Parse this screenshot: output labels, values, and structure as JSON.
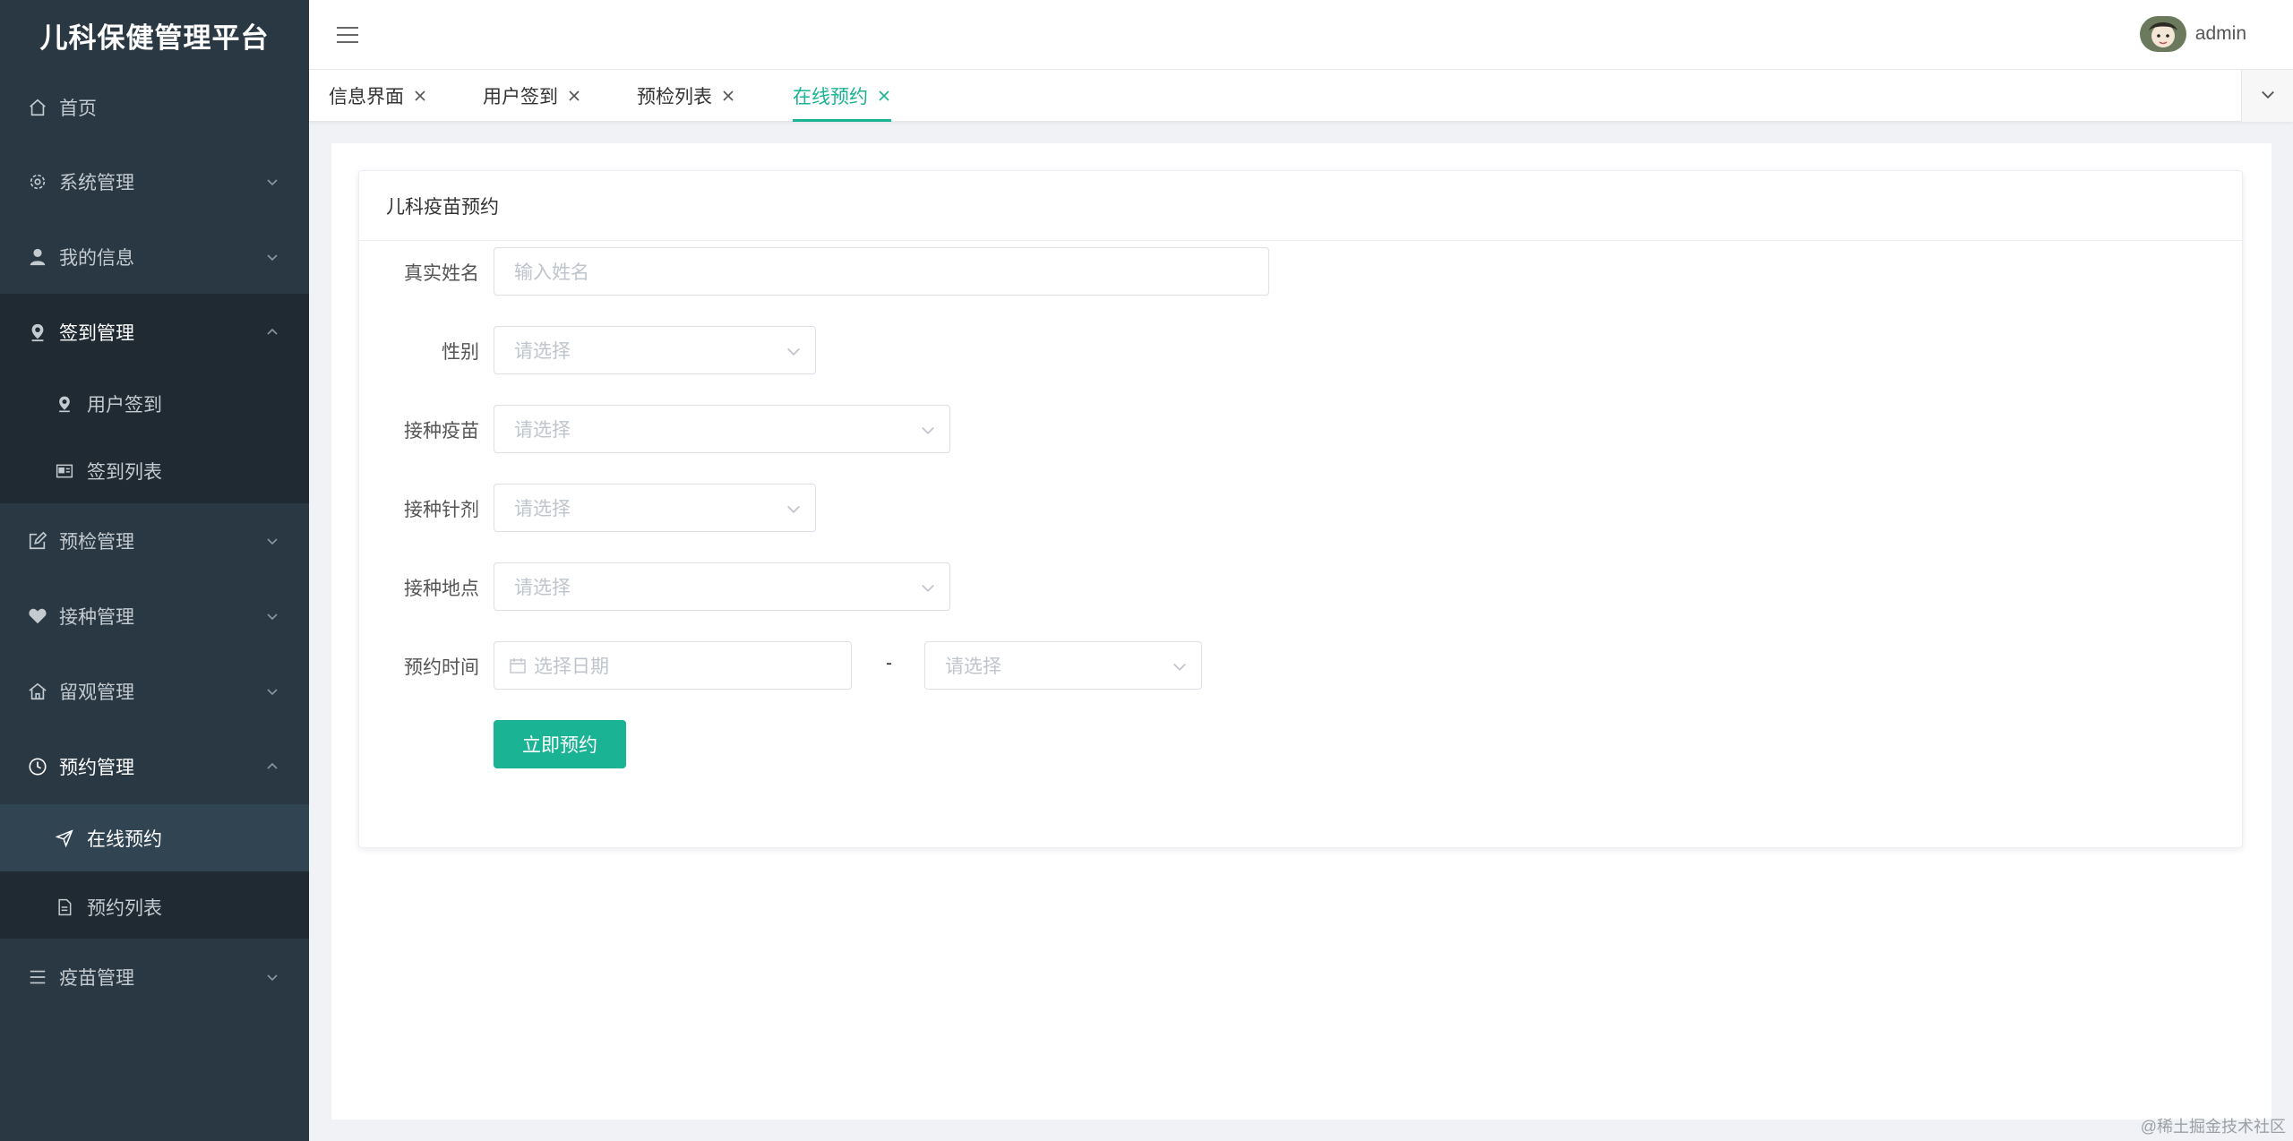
{
  "app": {
    "brand": "儿科保健管理平台"
  },
  "header": {
    "username": "admin"
  },
  "sidebar": {
    "items": [
      {
        "label": "首页",
        "icon": "home-icon"
      },
      {
        "label": "系统管理",
        "icon": "gear-icon"
      },
      {
        "label": "我的信息",
        "icon": "user-icon"
      },
      {
        "label": "签到管理",
        "icon": "location-pin-icon"
      },
      {
        "label": "用户签到",
        "icon": "location-pin-icon"
      },
      {
        "label": "签到列表",
        "icon": "id-card-icon"
      },
      {
        "label": "预检管理",
        "icon": "edit-icon"
      },
      {
        "label": "接种管理",
        "icon": "heart-icon"
      },
      {
        "label": "留观管理",
        "icon": "house-icon"
      },
      {
        "label": "预约管理",
        "icon": "clock-icon"
      },
      {
        "label": "在线预约",
        "icon": "send-icon"
      },
      {
        "label": "预约列表",
        "icon": "document-icon"
      },
      {
        "label": "疫苗管理",
        "icon": "list-icon"
      }
    ]
  },
  "tabs": [
    {
      "label": "信息界面"
    },
    {
      "label": "用户签到"
    },
    {
      "label": "预检列表"
    },
    {
      "label": "在线预约"
    }
  ],
  "form": {
    "title": "儿科疫苗预约",
    "name_label": "真实姓名",
    "name_placeholder": "输入姓名",
    "gender_label": "性别",
    "gender_placeholder": "请选择",
    "vaccine_label": "接种疫苗",
    "vaccine_placeholder": "请选择",
    "dose_label": "接种针剂",
    "dose_placeholder": "请选择",
    "location_label": "接种地点",
    "location_placeholder": "请选择",
    "time_label": "预约时间",
    "date_placeholder": "选择日期",
    "separator": "-",
    "slot_placeholder": "请选择",
    "submit": "立即预约"
  },
  "watermark": "@稀土掘金技术社区",
  "colors": {
    "accent": "#1ab394",
    "sidebar_bg": "#2a3843",
    "sidebar_sub_bg": "#1f2a33"
  }
}
